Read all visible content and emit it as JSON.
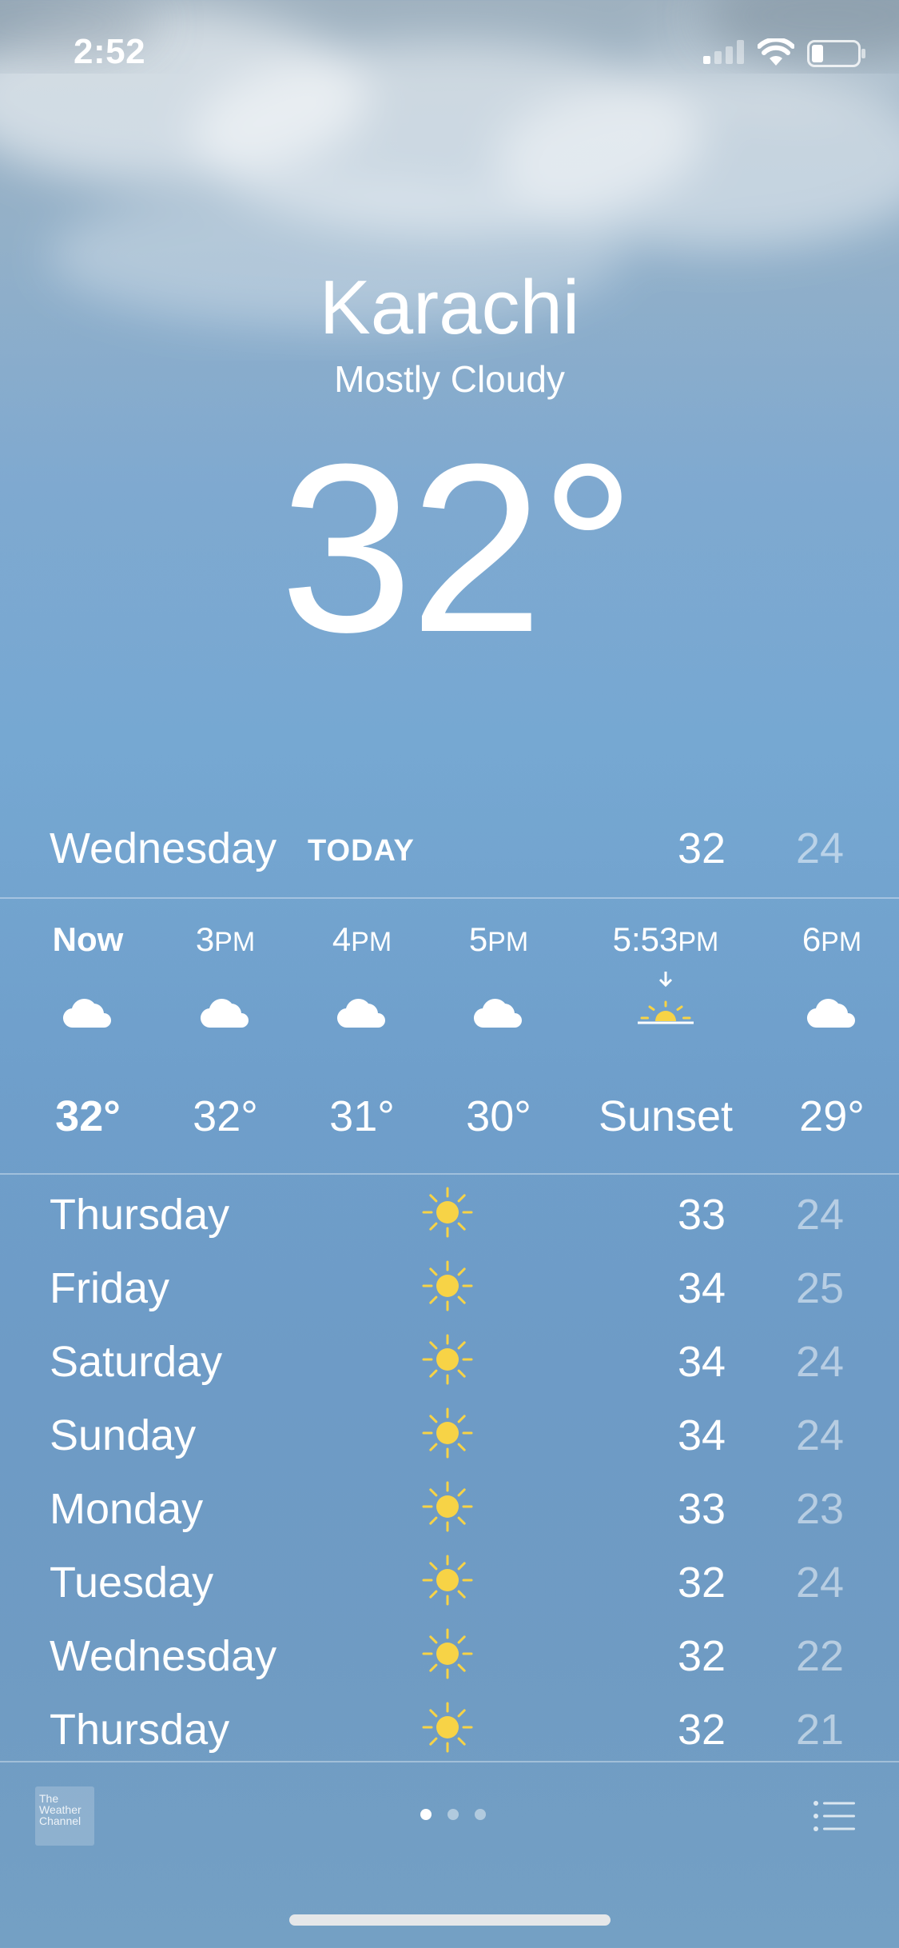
{
  "status": {
    "time": "2:52"
  },
  "location": {
    "city": "Karachi",
    "condition": "Mostly Cloudy",
    "temperature": "32°"
  },
  "today": {
    "day": "Wednesday",
    "tag": "TODAY",
    "high": "32",
    "low": "24"
  },
  "hourly": [
    {
      "label": "Now",
      "value": "32°",
      "icon": "cloud-icon"
    },
    {
      "label_num": "3",
      "label_suffix": "PM",
      "value": "32°",
      "icon": "cloud-icon"
    },
    {
      "label_num": "4",
      "label_suffix": "PM",
      "value": "31°",
      "icon": "cloud-icon"
    },
    {
      "label_num": "5",
      "label_suffix": "PM",
      "value": "30°",
      "icon": "cloud-icon"
    },
    {
      "label_num": "5:53",
      "label_suffix": "PM",
      "value": "Sunset",
      "icon": "sunset-icon"
    },
    {
      "label_num": "6",
      "label_suffix": "PM",
      "value": "29°",
      "icon": "cloud-icon"
    }
  ],
  "daily": [
    {
      "day": "Thursday",
      "high": "33",
      "low": "24",
      "icon": "sun-icon"
    },
    {
      "day": "Friday",
      "high": "34",
      "low": "25",
      "icon": "sun-icon"
    },
    {
      "day": "Saturday",
      "high": "34",
      "low": "24",
      "icon": "sun-icon"
    },
    {
      "day": "Sunday",
      "high": "34",
      "low": "24",
      "icon": "sun-icon"
    },
    {
      "day": "Monday",
      "high": "33",
      "low": "23",
      "icon": "sun-icon"
    },
    {
      "day": "Tuesday",
      "high": "32",
      "low": "24",
      "icon": "sun-icon"
    },
    {
      "day": "Wednesday",
      "high": "32",
      "low": "22",
      "icon": "sun-icon"
    },
    {
      "day": "Thursday",
      "high": "32",
      "low": "21",
      "icon": "sun-icon"
    }
  ],
  "footer": {
    "logo_text": [
      "The",
      "Weather",
      "Channel"
    ],
    "page_count": 3,
    "active_page": 1
  },
  "colors": {
    "sun": "#f7d346",
    "sky_top": "#9fb1bf",
    "sky_bottom": "#74a0c4"
  }
}
